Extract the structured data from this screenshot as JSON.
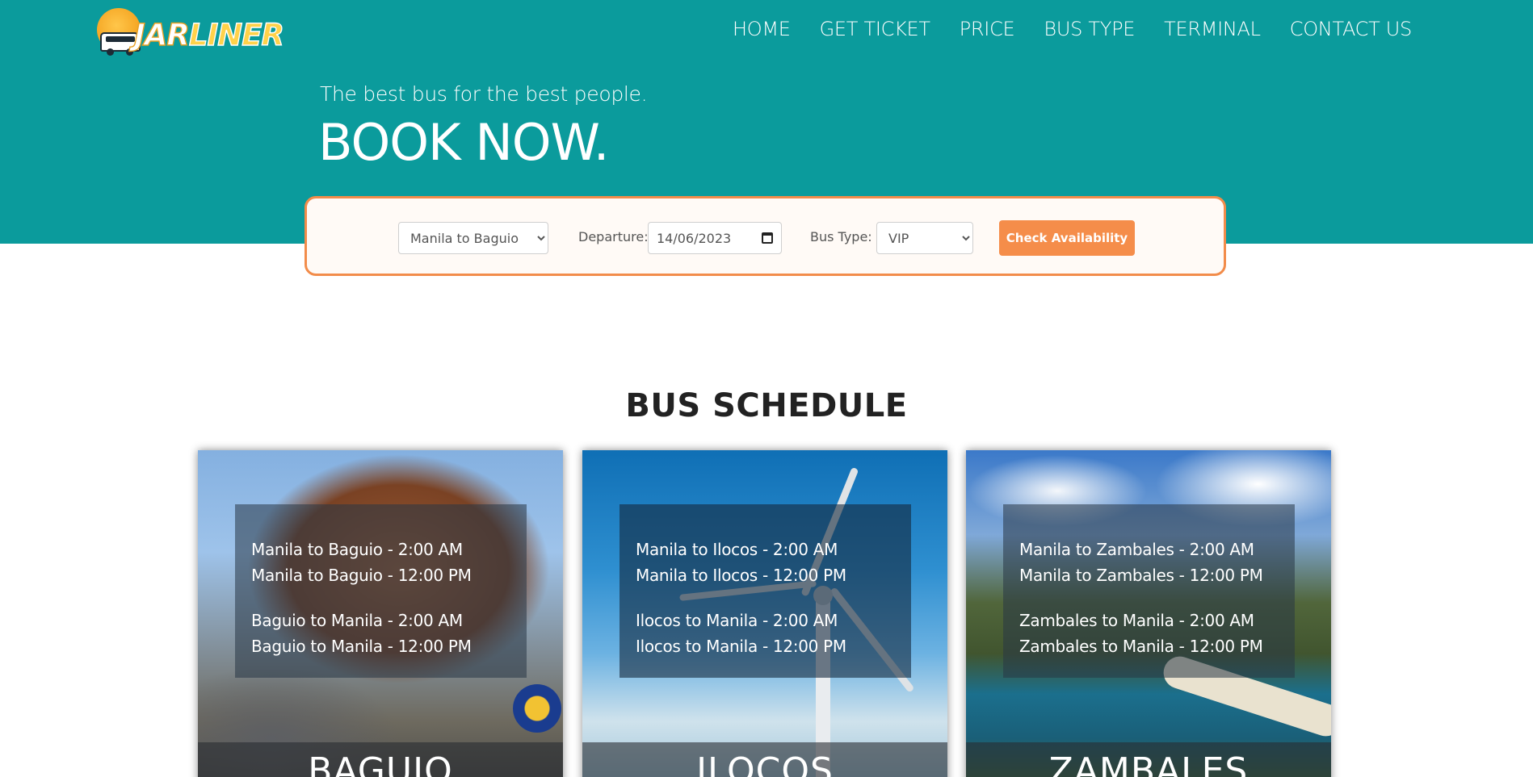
{
  "brand": {
    "part1": "JAR",
    "part2": "LINER"
  },
  "nav": [
    {
      "label": "HOME"
    },
    {
      "label": "GET TICKET"
    },
    {
      "label": "PRICE"
    },
    {
      "label": "BUS TYPE"
    },
    {
      "label": "TERMINAL"
    },
    {
      "label": "CONTACT US"
    }
  ],
  "hero": {
    "tagline": "The best bus for the best people.",
    "headline": "BOOK NOW."
  },
  "booking": {
    "route_value": "Manila to Baguio",
    "departure_label": "Departure:",
    "departure_value": "14/06/2023",
    "bus_type_label": "Bus Type:",
    "bus_type_value": "VIP",
    "check_label": "Check Availability"
  },
  "schedule": {
    "title": "BUS SCHEDULE",
    "cards": [
      {
        "city": "BAGUIO",
        "outbound": [
          "Manila to Baguio - 2:00 AM",
          "Manila to Baguio - 12:00 PM"
        ],
        "inbound": [
          "Baguio to Manila - 2:00 AM",
          "Baguio to Manila - 12:00 PM"
        ]
      },
      {
        "city": "ILOCOS",
        "outbound": [
          "Manila to Ilocos - 2:00 AM",
          "Manila to Ilocos - 12:00 PM"
        ],
        "inbound": [
          "Ilocos to Manila - 2:00 AM",
          "Ilocos to Manila - 12:00 PM"
        ]
      },
      {
        "city": "ZAMBALES",
        "outbound": [
          "Manila to Zambales - 2:00 AM",
          "Manila to Zambales - 12:00 PM"
        ],
        "inbound": [
          "Zambales to Manila - 2:00 AM",
          "Zambales to Manila - 12:00 PM"
        ]
      }
    ]
  },
  "colors": {
    "teal": "#0b9b9c",
    "orange": "#f58d4a"
  }
}
